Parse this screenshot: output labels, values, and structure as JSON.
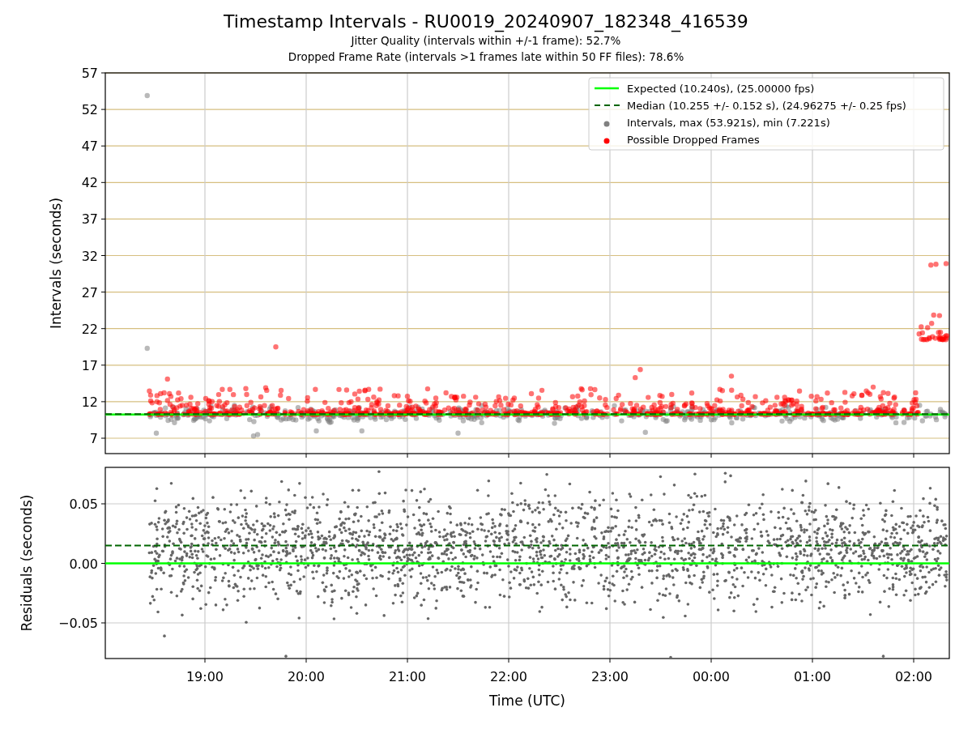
{
  "figure": {
    "title": "Timestamp Intervals - RU0019_20240907_182348_416539",
    "subtitles": [
      "Jitter Quality (intervals within +/-1 frame): 52.7%",
      "Dropped Frame Rate (intervals >1 frames late within 50 FF files): 78.6%"
    ]
  },
  "top_panel": {
    "y_axis_label": "Intervals (seconds)",
    "y_tick_labels": [
      "57",
      "52",
      "47",
      "42",
      "37",
      "32",
      "27",
      "22",
      "17",
      "12",
      "7"
    ],
    "legend": [
      {
        "label": "Expected (10.240s), (25.00000 fps)",
        "kind": "line",
        "color": "#00ff00"
      },
      {
        "label": "Median (10.255 +/- 0.152 s), (24.96275 +/- 0.25 fps)",
        "kind": "dashed",
        "color": "#006400"
      },
      {
        "label": "Intervals, max (53.921s), min (7.221s)",
        "kind": "dot",
        "color": "#808080"
      },
      {
        "label": "Possible Dropped Frames",
        "kind": "dot",
        "color": "#ff0000"
      }
    ]
  },
  "bottom_panel": {
    "y_axis_label": "Residuals (seconds)",
    "y_tick_labels": [
      "0.05",
      "0.00",
      "−0.05"
    ],
    "x_tick_labels": [
      "19:00",
      "20:00",
      "21:00",
      "22:00",
      "23:00",
      "00:00",
      "01:00",
      "02:00"
    ],
    "x_axis_label": "Time (UTC)"
  }
}
